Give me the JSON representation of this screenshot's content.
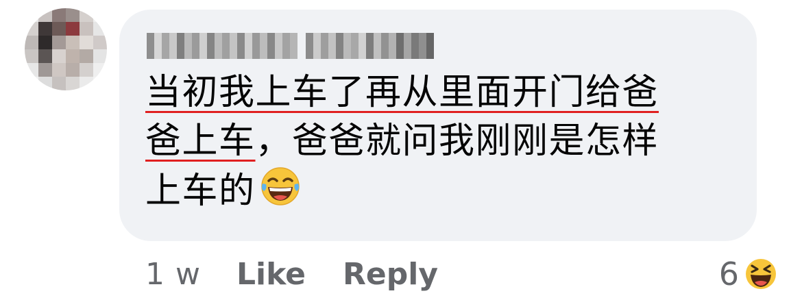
{
  "comment": {
    "author_name_redacted": "Catherine Orbit",
    "message_lines": [
      {
        "underlined": "当初我上车了再从里面开门给爸",
        "plain": ""
      },
      {
        "underlined": "爸上车",
        "plain": "，爸爸就问我刚刚是怎样"
      },
      {
        "underlined": "",
        "plain": "上车的"
      }
    ],
    "message_emoji": "laughing-tears-icon",
    "timestamp": "1 w",
    "like_label": "Like",
    "reply_label": "Reply",
    "reaction_count": "6",
    "reaction_icon": "haha-reaction-icon"
  },
  "colors": {
    "bubble": "#f0f2f5",
    "text": "#050505",
    "meta": "#65676b",
    "underline": "#e02020",
    "emoji": "#f7c53b"
  }
}
